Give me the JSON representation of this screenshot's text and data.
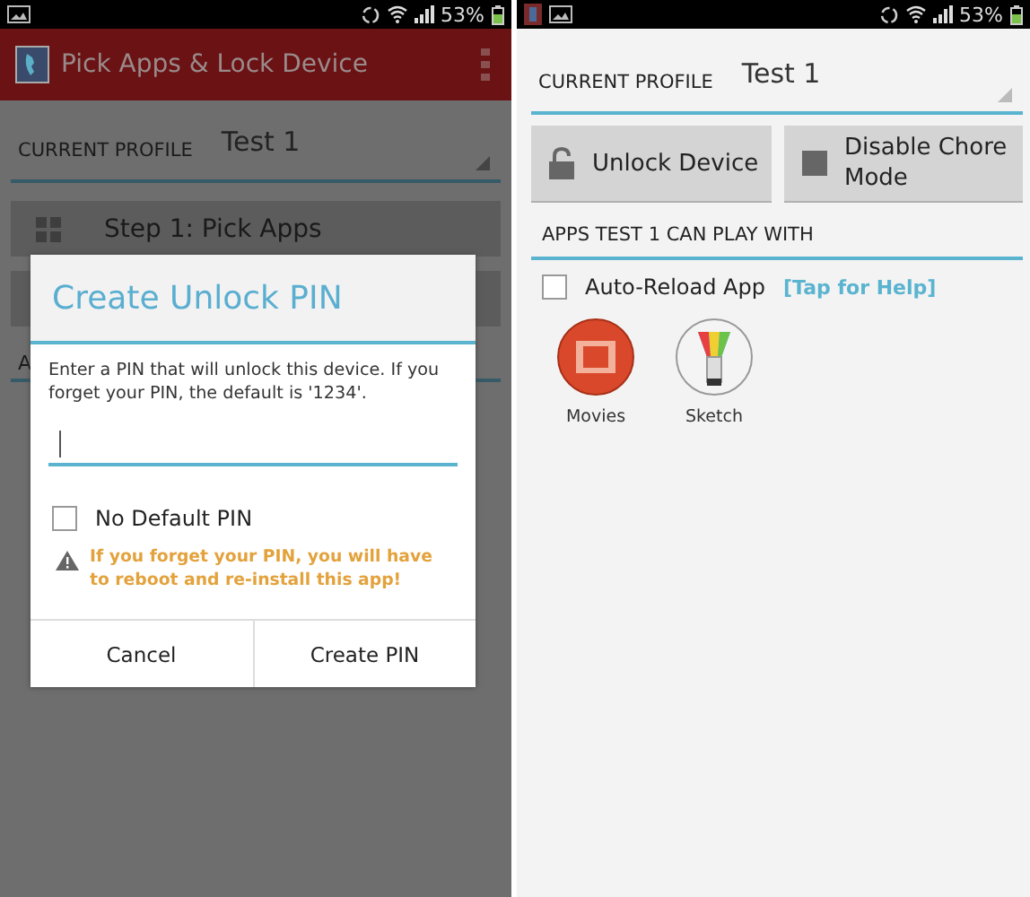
{
  "left": {
    "status_bar": {
      "battery_text": "53%"
    },
    "action_bar": {
      "title": "Pick Apps & Lock Device"
    },
    "profile": {
      "label": "CURRENT PROFILE",
      "value": "Test 1"
    },
    "steps": [
      {
        "label": "Step 1: Pick Apps"
      }
    ],
    "section_heading": "A",
    "dialog": {
      "title": "Create Unlock PIN",
      "message": "Enter a PIN that will unlock this device. If you forget your PIN, the default is '1234'.",
      "no_default_pin": {
        "label": "No Default PIN",
        "checked": false
      },
      "warning": "If you forget your PIN, you will have to reboot and re-install this app!",
      "buttons": [
        "Cancel",
        "Create PIN"
      ]
    }
  },
  "right": {
    "status_bar": {
      "battery_text": "53%"
    },
    "profile": {
      "label": "CURRENT PROFILE",
      "value": "Test 1"
    },
    "buttons": [
      {
        "kind": "lock",
        "label": "Unlock Device"
      },
      {
        "kind": "square",
        "label": "Disable Chore Mode"
      }
    ],
    "section_heading": "APPS TEST 1 CAN PLAY WITH",
    "auto_reload": {
      "label": "Auto-Reload App",
      "checked": false,
      "help_link": "[Tap for Help]"
    },
    "apps": [
      {
        "kind": "movies",
        "name": "Movies"
      },
      {
        "kind": "sketch",
        "name": "Sketch"
      }
    ]
  }
}
